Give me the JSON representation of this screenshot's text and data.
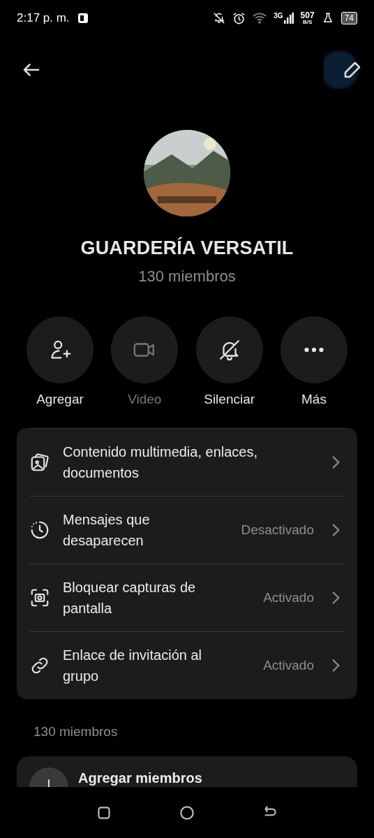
{
  "status_bar": {
    "time": "2:17 p. m.",
    "network": "3G",
    "speed": "507",
    "speed_unit": "B/S",
    "battery": "74"
  },
  "group": {
    "name": "GUARDERÍA VERSATIL",
    "members": "130 miembros"
  },
  "actions": [
    {
      "label": "Agregar",
      "disabled": false
    },
    {
      "label": "Video",
      "disabled": true
    },
    {
      "label": "Silenciar",
      "disabled": false
    },
    {
      "label": "Más",
      "disabled": false
    }
  ],
  "settings": [
    {
      "label": "Contenido multimedia, enlaces, documentos"
    },
    {
      "label": "Mensajes que desaparecen",
      "value": "Desactivado"
    },
    {
      "label": "Bloquear capturas de pantalla",
      "value": "Activado"
    },
    {
      "label": "Enlace de invitación al grupo",
      "value": "Activado"
    }
  ],
  "members_section": {
    "title": "130 miembros",
    "add_label": "Agregar miembros"
  }
}
